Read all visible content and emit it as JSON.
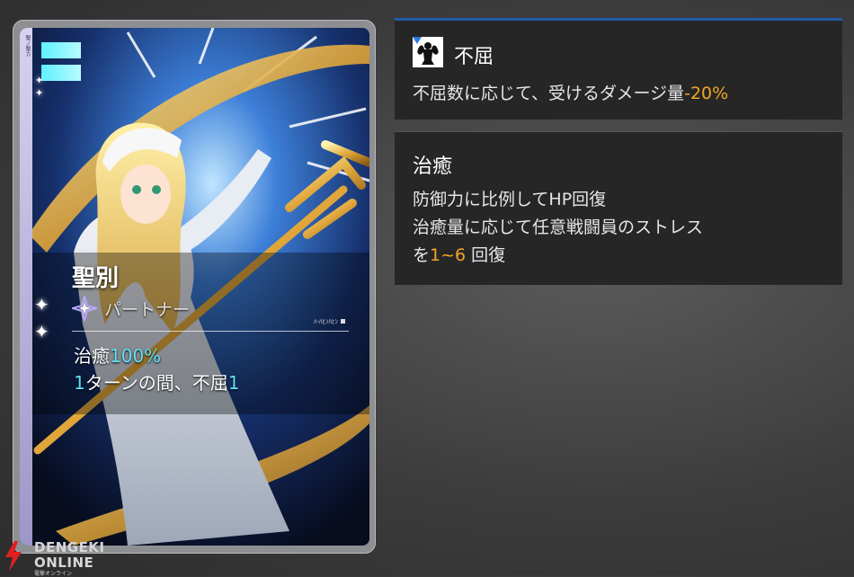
{
  "card": {
    "strip_text": "聖ノ聖カ",
    "name": "聖別",
    "type_label": "パートナー",
    "type_icon": "sparkle-star-icon",
    "code": "ﾊ-ﾊﾋﾝﾊﾋﾝ",
    "effect_line1_prefix": "治癒",
    "effect_line1_value": "100%",
    "effect_line2_num": "1",
    "effect_line2_text": "ターンの間、不屈",
    "effect_line2_value": "1"
  },
  "panels": [
    {
      "icon": "muscle-flex-icon",
      "title": "不屈",
      "desc_prefix": "不屈数に応じて、受けるダメージ量",
      "desc_value": "-20%"
    },
    {
      "title": "治癒",
      "line1": "防御力に比例してHP回復",
      "line2": "治癒量に応じて任意戦闘員のストレス",
      "line3_prefix": "を",
      "line3_value": "1~6",
      "line3_suffix": " 回復"
    }
  ],
  "watermark": {
    "line1": "DENGEKI",
    "line2": "ONLINE",
    "line3": "電撃オンライン"
  },
  "colors": {
    "highlight_cyan": "#5fe0f6",
    "highlight_orange": "#f5a524",
    "panel_accent": "#1f5aa6"
  }
}
